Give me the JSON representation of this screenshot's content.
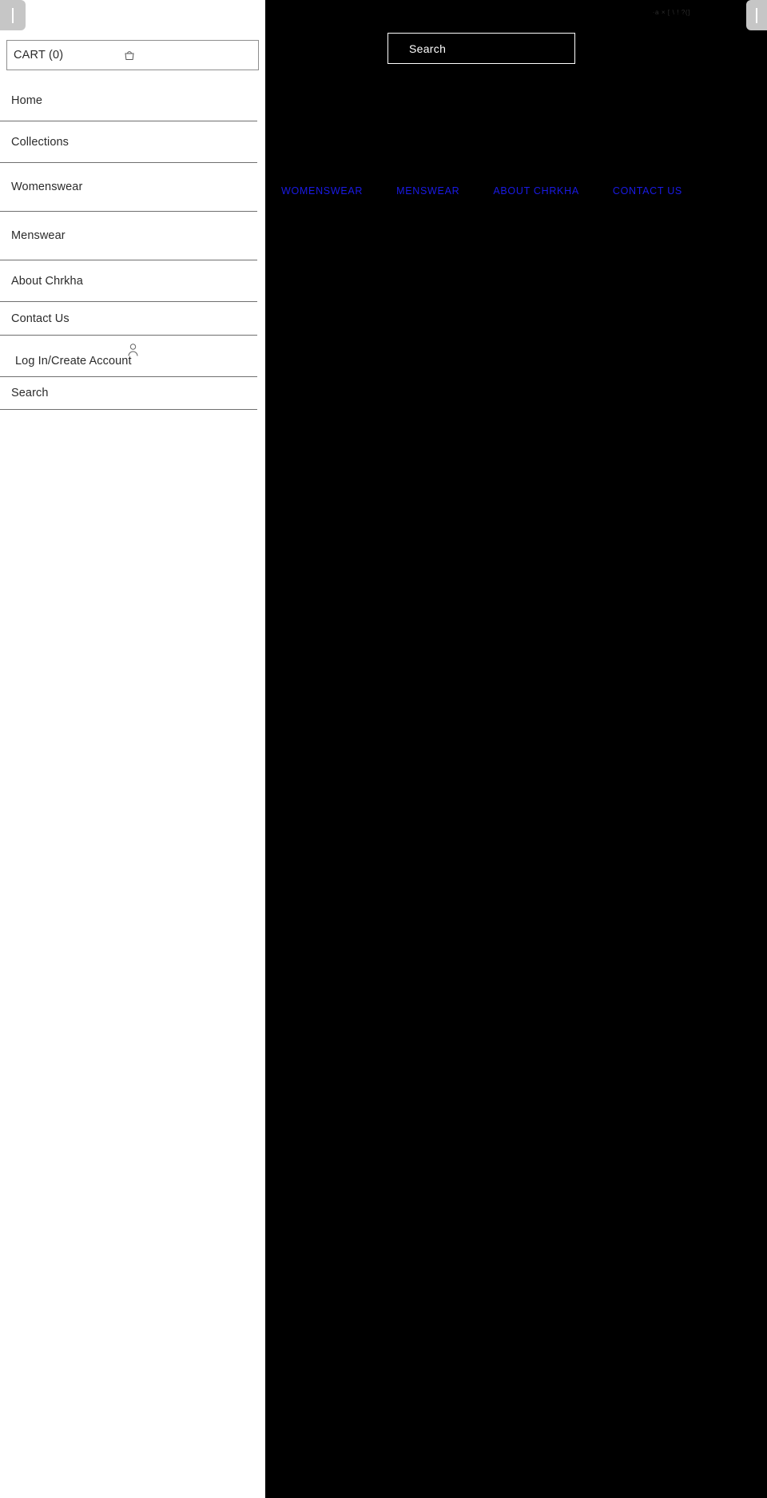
{
  "sidebar": {
    "drag_handle": "|",
    "cart": {
      "label": "CART (0)",
      "icon": "shopping-bag-icon",
      "count": 0
    },
    "items": [
      {
        "label": "Home"
      },
      {
        "label": "Collections"
      },
      {
        "label": "Womenswear"
      },
      {
        "label": "Menswear"
      },
      {
        "label": "About Chrkha"
      },
      {
        "label": "Contact Us"
      }
    ],
    "account": {
      "label": "Log In/Create Account",
      "icon": "person-icon"
    },
    "search": {
      "label": "Search"
    }
  },
  "content": {
    "handle": "|",
    "status_text": "·a  ×  [  \\  ! ?(]",
    "search": {
      "value": "Search",
      "placeholder": "Search"
    },
    "nav_links": [
      {
        "label": "WOMENSWEAR"
      },
      {
        "label": "MENSWEAR"
      },
      {
        "label": "ABOUT CHRKHA"
      },
      {
        "label": "CONTACT US"
      }
    ]
  },
  "colors": {
    "link_blue": "#1a1ae6",
    "panel_dark": "#000000",
    "panel_light": "#ffffff",
    "handle_grey": "#c6c6c6",
    "rule_grey": "#6f6f6f"
  }
}
